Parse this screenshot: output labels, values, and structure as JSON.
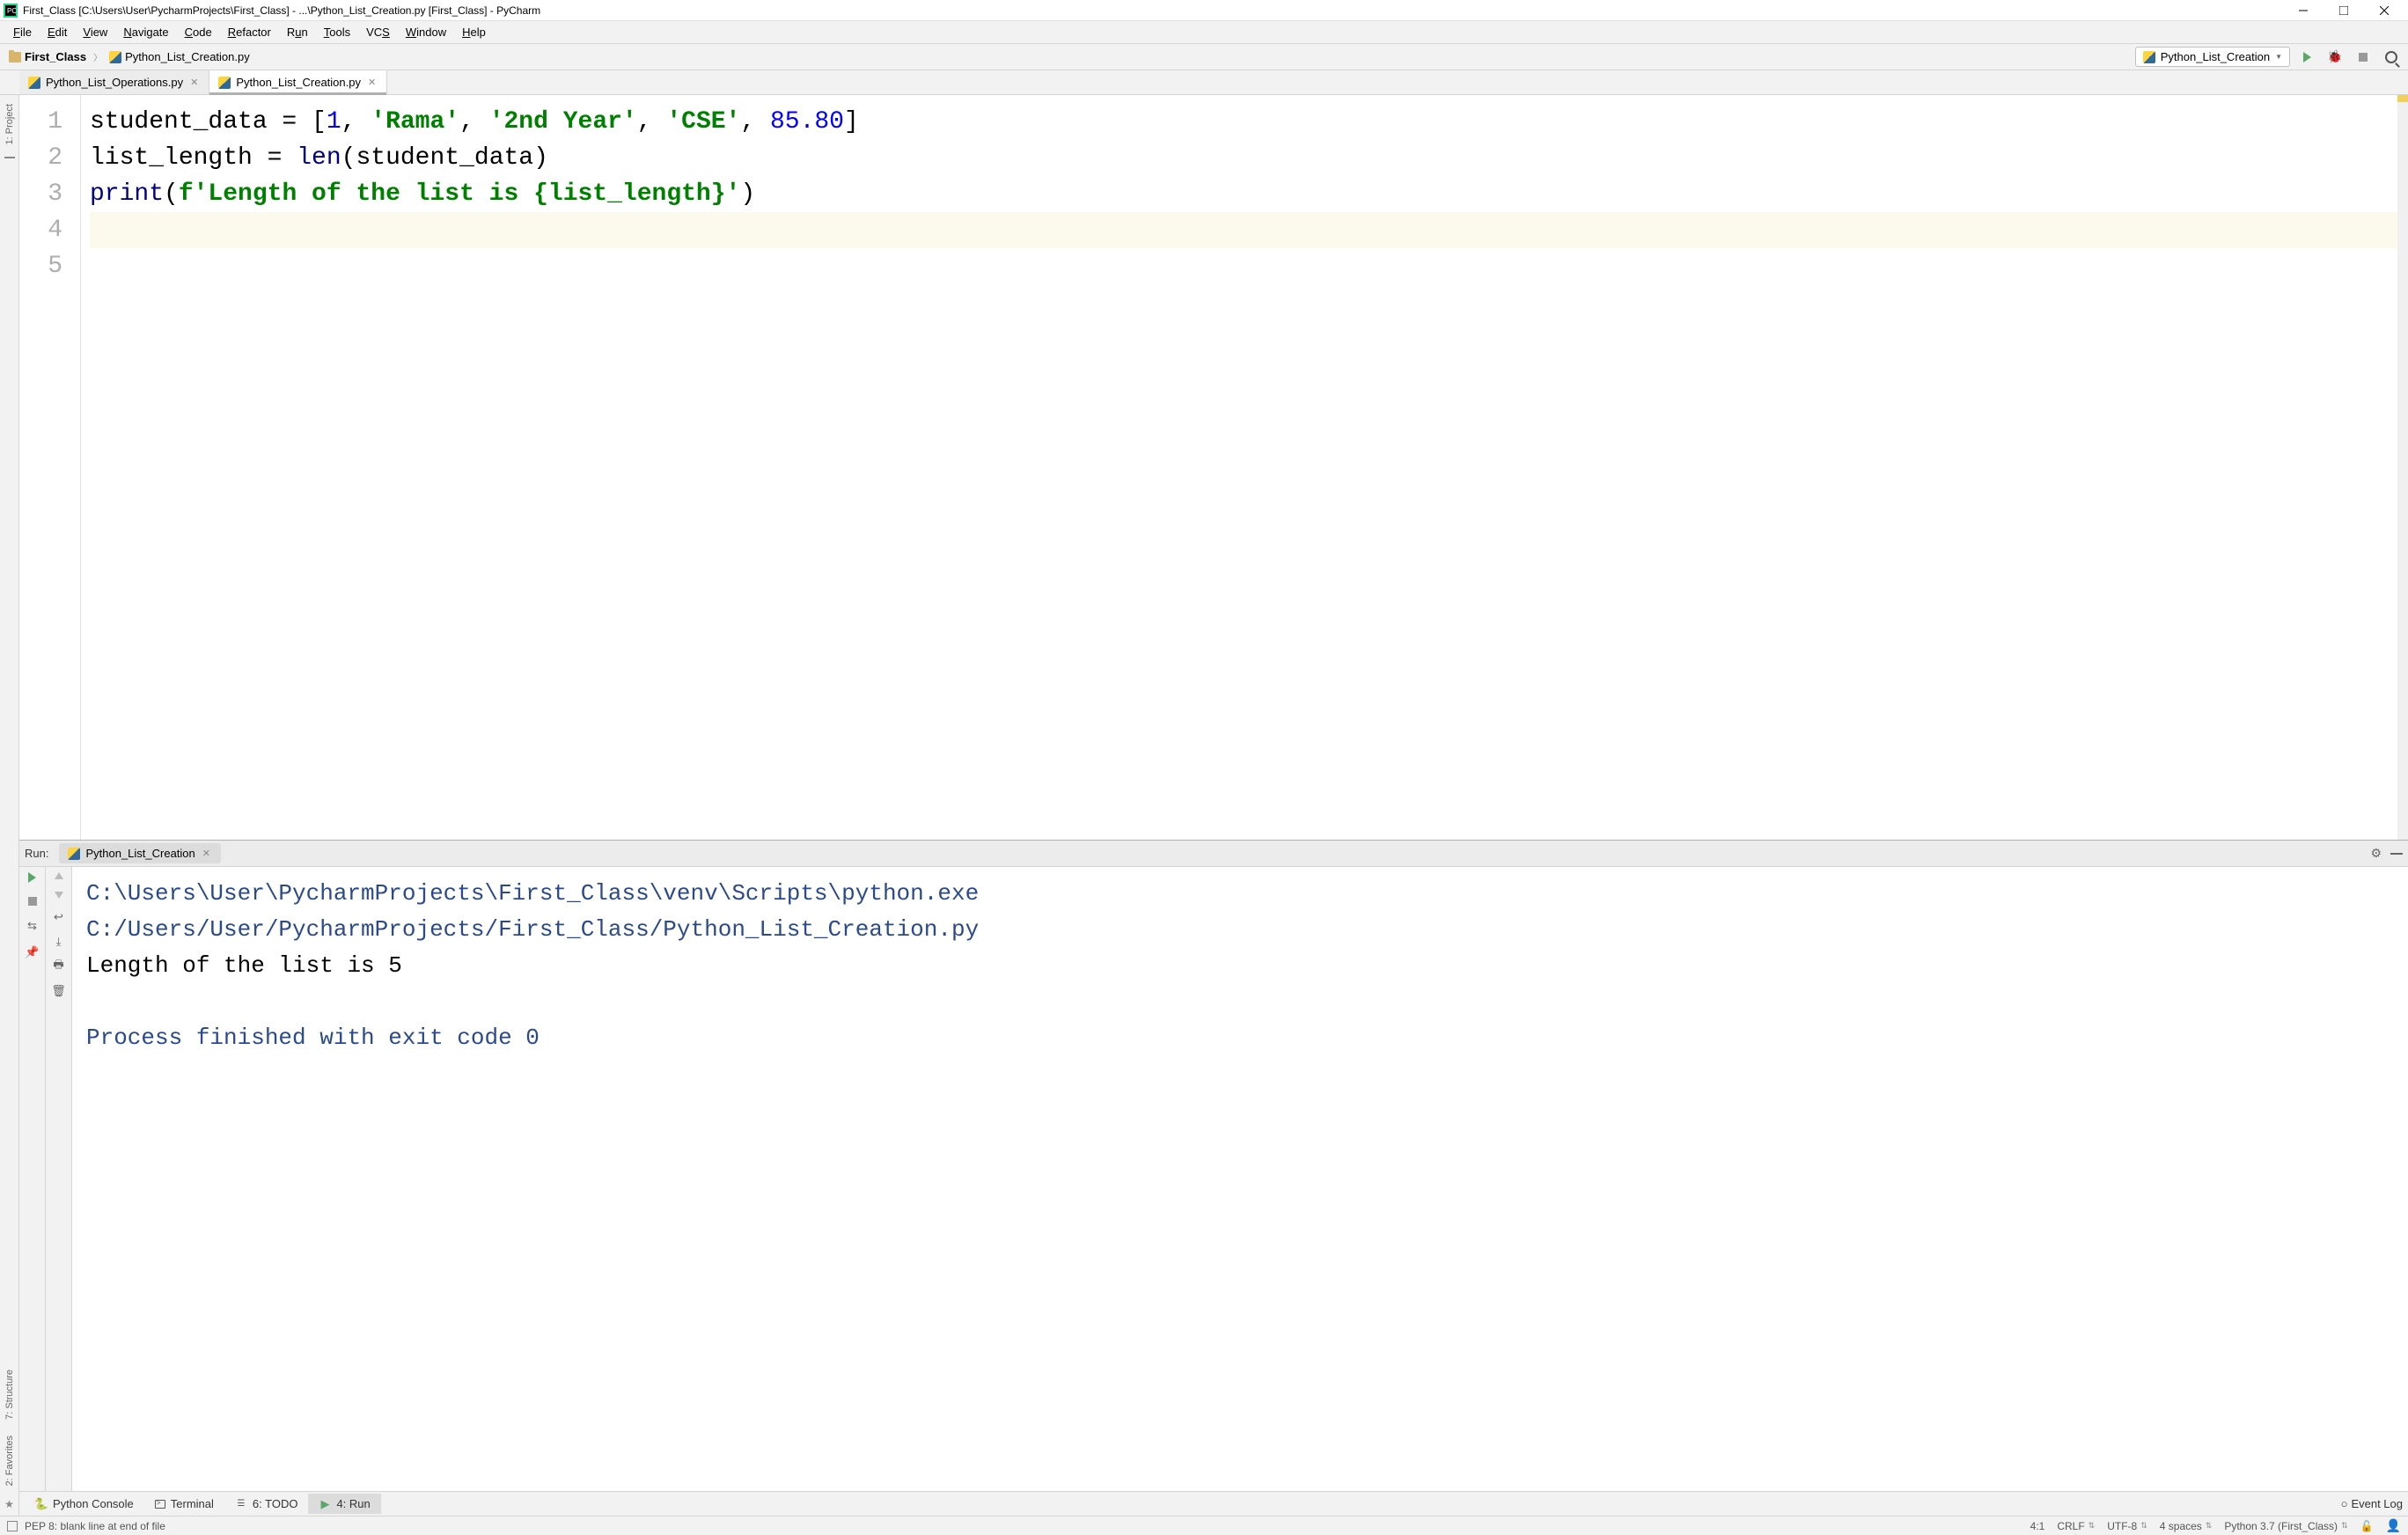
{
  "window": {
    "title": "First_Class [C:\\Users\\User\\PycharmProjects\\First_Class] - ...\\Python_List_Creation.py [First_Class] - PyCharm"
  },
  "menu": {
    "file": "File",
    "edit": "Edit",
    "view": "View",
    "navigate": "Navigate",
    "code": "Code",
    "refactor": "Refactor",
    "run": "Run",
    "tools": "Tools",
    "vcs": "VCS",
    "window": "Window",
    "help": "Help"
  },
  "breadcrumb": {
    "project": "First_Class",
    "file": "Python_List_Creation.py"
  },
  "run_config": {
    "name": "Python_List_Creation"
  },
  "tabs": {
    "tab1": "Python_List_Operations.py",
    "tab2": "Python_List_Creation.py"
  },
  "sidebar": {
    "project": "1: Project",
    "structure": "7: Structure",
    "favorites": "2: Favorites"
  },
  "editor": {
    "lines": [
      "1",
      "2",
      "3",
      "4",
      "5"
    ],
    "code": {
      "l1_a": "student_data = [",
      "l1_n1": "1",
      "l1_c1": ", ",
      "l1_s1": "'Rama'",
      "l1_c2": ", ",
      "l1_s2": "'2nd Year'",
      "l1_c3": ", ",
      "l1_s3": "'CSE'",
      "l1_c4": ", ",
      "l1_n2": "85.80",
      "l1_b": "]",
      "l2_a": "list_length = ",
      "l2_b": "len",
      "l2_c": "(student_data)",
      "l3_a": "print",
      "l3_b": "(",
      "l3_c": "f'Length of the list is ",
      "l3_d": "{list_length}",
      "l3_e": "'",
      "l3_f": ")"
    }
  },
  "run_panel": {
    "label": "Run:",
    "tab_name": "Python_List_Creation",
    "output": {
      "path1": "C:\\Users\\User\\PycharmProjects\\First_Class\\venv\\Scripts\\python.exe ",
      "path2": "C:/Users/User/PycharmProjects/First_Class/Python_List_Creation.py",
      "line1": "Length of the list is 5",
      "line2": "Process finished with exit code 0"
    }
  },
  "bottom_tabs": {
    "python_console": "Python Console",
    "terminal": "Terminal",
    "todo": "6: TODO",
    "run": "4: Run",
    "event_log": "Event Log"
  },
  "status": {
    "message": "PEP 8: blank line at end of file",
    "position": "4:1",
    "line_sep": "CRLF",
    "encoding": "UTF-8",
    "indent": "4 spaces",
    "interpreter": "Python 3.7 (First_Class)"
  }
}
